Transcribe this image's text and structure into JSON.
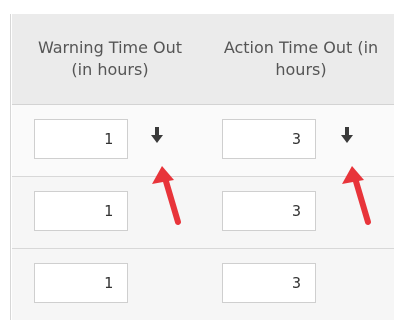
{
  "columns": [
    {
      "header": "Warning Time Out\n(in hours)",
      "values": [
        "1",
        "1",
        "1"
      ]
    },
    {
      "header": "Action Time Out (in\nhours)",
      "values": [
        "3",
        "3",
        "3"
      ]
    }
  ],
  "icons": {
    "sort": "down-arrow-icon",
    "annotation": "red-arrow-icon"
  },
  "colors": {
    "header_bg": "#ebebeb",
    "annotation_red": "#e8343a",
    "grid_line": "#d7d7d7"
  }
}
